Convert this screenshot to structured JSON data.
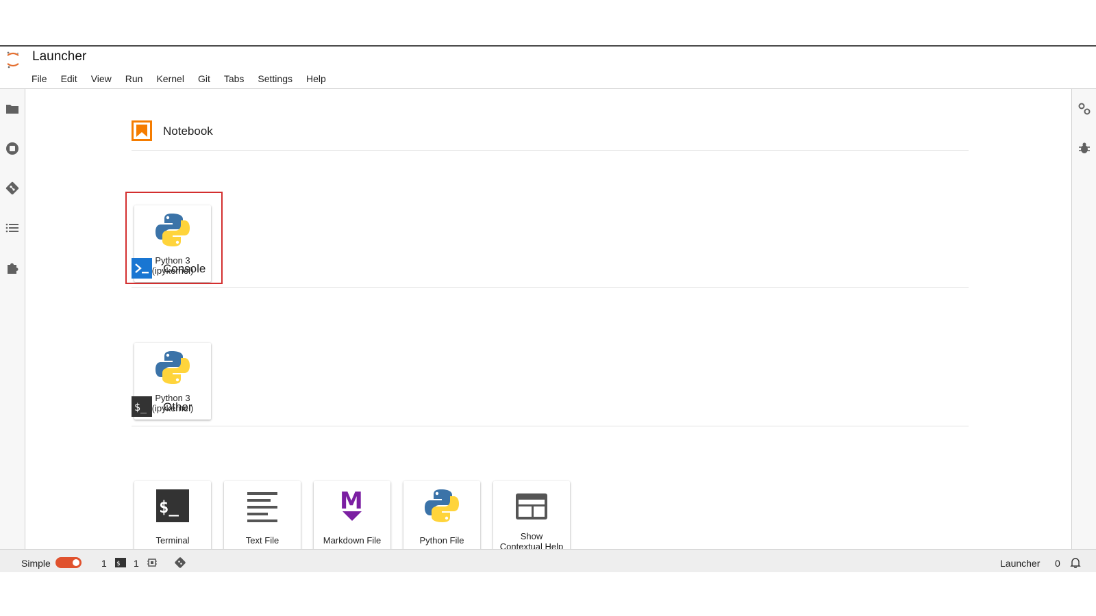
{
  "app": {
    "title": "Launcher"
  },
  "menu": [
    "File",
    "Edit",
    "View",
    "Run",
    "Kernel",
    "Git",
    "Tabs",
    "Settings",
    "Help"
  ],
  "left_sidebar": {
    "icons": [
      "folder-icon",
      "running-kernels-icon",
      "git-icon",
      "table-of-contents-icon",
      "extension-manager-icon"
    ]
  },
  "right_sidebar": {
    "icons": [
      "property-inspector-icon",
      "debugger-icon"
    ]
  },
  "sections": {
    "notebook": {
      "title": "Notebook",
      "cards": [
        {
          "label_line1": "Python 3",
          "label_line2": "(ipykernel)",
          "icon": "python-icon"
        }
      ]
    },
    "console": {
      "title": "Console",
      "cards": [
        {
          "label_line1": "Python 3",
          "label_line2": "(ipykernel)",
          "icon": "python-icon"
        }
      ]
    },
    "other": {
      "title": "Other",
      "cards": [
        {
          "label": "Terminal",
          "icon": "terminal-icon"
        },
        {
          "label": "Text File",
          "icon": "text-file-icon"
        },
        {
          "label": "Markdown File",
          "icon": "markdown-icon"
        },
        {
          "label": "Python File",
          "icon": "python-icon"
        },
        {
          "label_line1": "Show",
          "label_line2": "Contextual Help",
          "icon": "contextual-help-icon"
        }
      ]
    }
  },
  "statusbar": {
    "mode_label": "Simple",
    "simple_mode_on": true,
    "terminals_count": "1",
    "kernels_count": "1",
    "active_tab": "Launcher",
    "notifications_count": "0"
  },
  "colors": {
    "accent": "#e0522e",
    "notebook_icon": "#f57c00",
    "console_icon": "#1976d2",
    "terminal_icon": "#333333",
    "markdown_icon": "#7b1fa2",
    "python_blue": "#3b73a8",
    "python_yellow": "#ffd43b",
    "highlight_box": "#d32f2f"
  }
}
